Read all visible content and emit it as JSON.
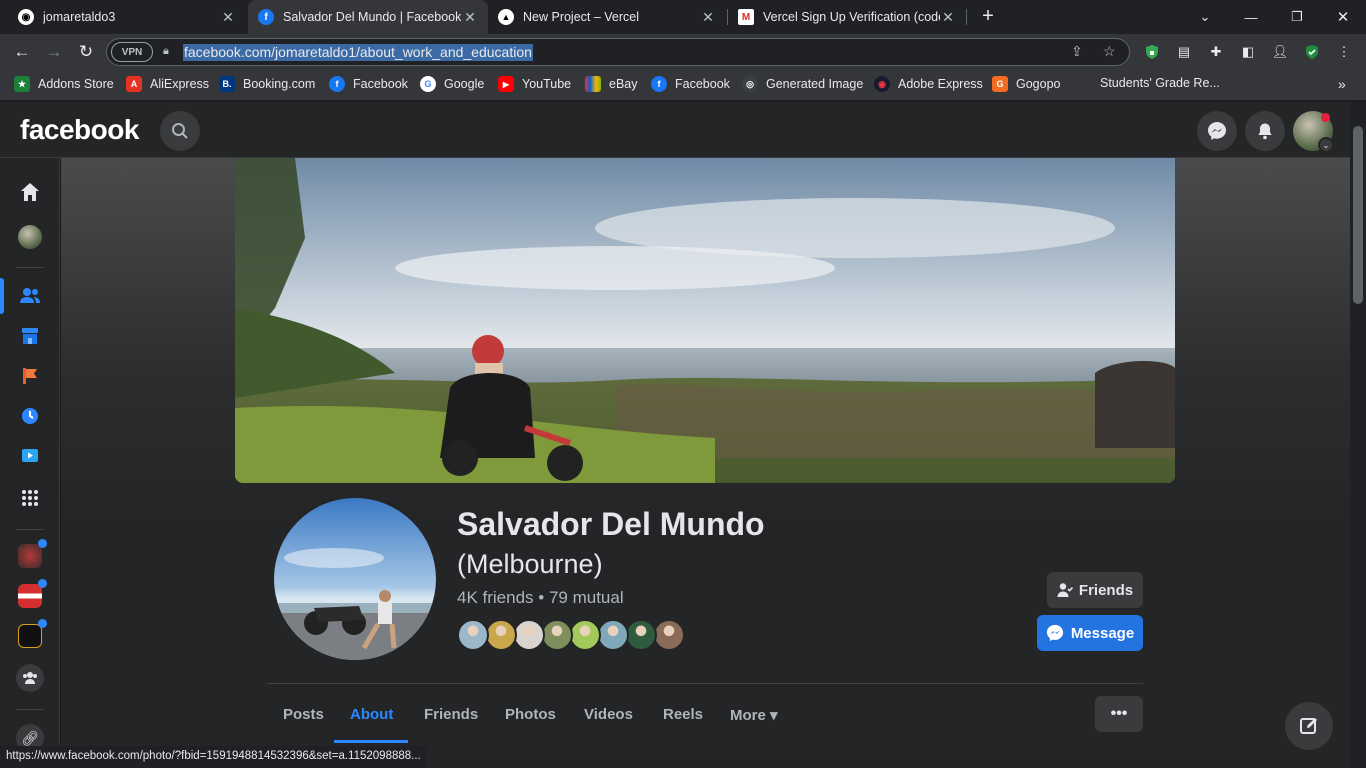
{
  "browser": {
    "tabs": [
      {
        "title": "jomaretaldo3",
        "icon": "github-icon"
      },
      {
        "title": "Salvador Del Mundo | Facebook",
        "icon": "facebook-icon"
      },
      {
        "title": "New Project – Vercel",
        "icon": "vercel-icon"
      },
      {
        "title": "Vercel Sign Up Verification (code",
        "icon": "gmail-icon"
      }
    ],
    "new_tab": "+",
    "address": "facebook.com/jomaretaldo1/about_work_and_education",
    "vpn_label": "VPN",
    "bookmarks": [
      {
        "label": "Addons Store",
        "color": "#1a7f37",
        "glyph": "★"
      },
      {
        "label": "AliExpress",
        "color": "#e43225",
        "glyph": "A"
      },
      {
        "label": "Booking.com",
        "color": "#003580",
        "glyph": "B."
      },
      {
        "label": "Facebook",
        "color": "#1877f2",
        "glyph": "f"
      },
      {
        "label": "Google",
        "color": "#ffffff",
        "glyph": "G"
      },
      {
        "label": "YouTube",
        "color": "#ff0000",
        "glyph": "▶"
      },
      {
        "label": "eBay",
        "color": "#2b2b2b",
        "glyph": "e"
      },
      {
        "label": "Facebook",
        "color": "#1877f2",
        "glyph": "f"
      },
      {
        "label": "Generated Image",
        "color": "#3c4043",
        "glyph": "◎"
      },
      {
        "label": "Adobe Express",
        "color": "#1a1a2e",
        "glyph": "◉"
      },
      {
        "label": "Gogopo",
        "color": "#f36c21",
        "glyph": "G"
      },
      {
        "label": "Students' Grade Re...",
        "color": "#35363a",
        "glyph": ""
      }
    ],
    "status_url": "https://www.facebook.com/photo/?fbid=1591948814532396&set=a.1152098888..."
  },
  "facebook": {
    "logo": "facebook",
    "accent": "#2d88ff",
    "profile": {
      "name": "Salvador Del Mundo",
      "subtitle": "(Melbourne)",
      "friends_line": "4K friends • 79 mutual",
      "mutual_avatar_colors": [
        "#9bb7c9",
        "#c9a74a",
        "#d9d4cf",
        "#7e8f5d",
        "#a3c95b",
        "#7fa9b8",
        "#2f5c3e",
        "#8a6b5a"
      ]
    },
    "buttons": {
      "friends": "Friends",
      "message": "Message",
      "more_options": "•••"
    },
    "tabs": [
      "Posts",
      "About",
      "Friends",
      "Photos",
      "Videos",
      "Reels",
      "More ▾"
    ],
    "active_tab": "About"
  }
}
